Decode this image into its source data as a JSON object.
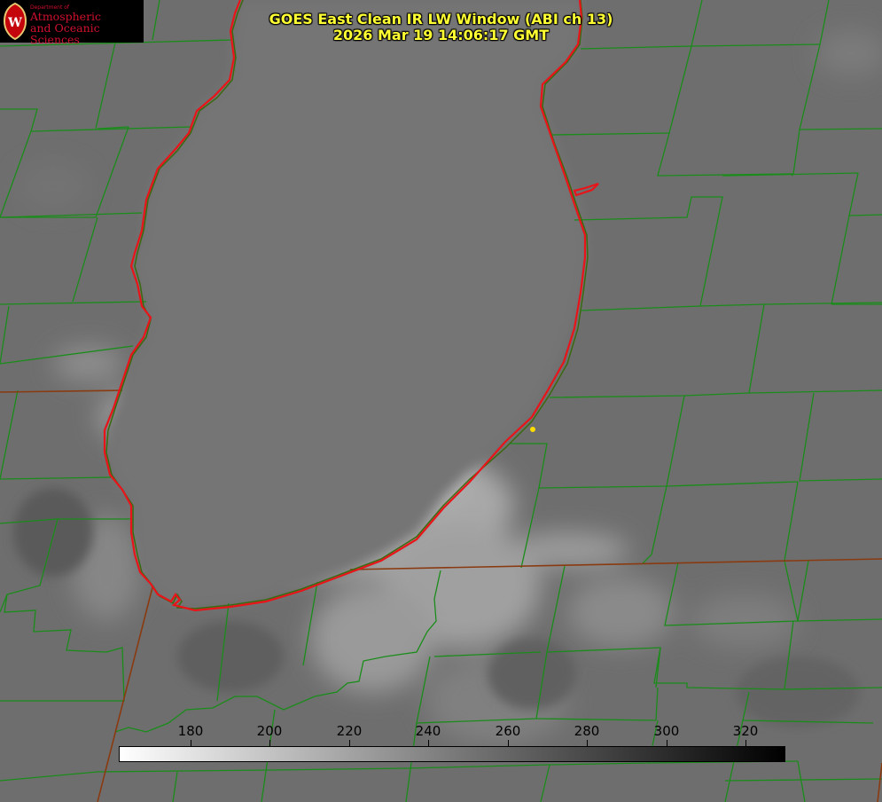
{
  "title": {
    "line1": "GOES East Clean IR LW Window (ABI ch 13)",
    "line2": "2026 Mar 19 14:06:17 GMT"
  },
  "logo": {
    "dept": "Department of",
    "line1": "Atmospheric",
    "line2": "and Oceanic Sciences",
    "crest_letter": "W"
  },
  "colorbar": {
    "ticks": [
      "180",
      "200",
      "220",
      "240",
      "260",
      "280",
      "300",
      "320"
    ],
    "gradient": [
      "#ffffff",
      "#000000"
    ]
  },
  "colors": {
    "background": "#6e6e6e",
    "lake": "#747474",
    "coastline": "#e8141a",
    "county_border": "#1a8c1a",
    "state_border": "#8a3a10",
    "title_text": "#ffff33",
    "logo_text": "#d0102e",
    "station_marker": "#ffdd00"
  },
  "icons": {
    "logo": "uw-crest-icon",
    "marker": "station-dot-icon"
  }
}
